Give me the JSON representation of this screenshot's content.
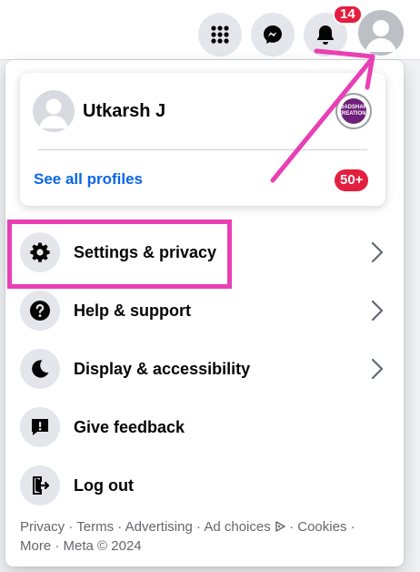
{
  "topbar": {
    "menu_icon": "grid-dots-icon",
    "messenger_icon": "messenger-icon",
    "notifications_icon": "bell-icon",
    "notifications_count": "14",
    "account_icon": "default-avatar-icon"
  },
  "profile_card": {
    "name": "Utkarsh J",
    "see_all_label": "See all profiles",
    "profile_count": "50+",
    "page_avatar_text": "BADSHAH CREATIONS"
  },
  "menu": {
    "items": [
      {
        "label": "Settings & privacy",
        "icon": "gear-icon",
        "has_chevron": true
      },
      {
        "label": "Help & support",
        "icon": "question-icon",
        "has_chevron": true
      },
      {
        "label": "Display & accessibility",
        "icon": "moon-icon",
        "has_chevron": true
      },
      {
        "label": "Give feedback",
        "icon": "feedback-icon",
        "has_chevron": false
      },
      {
        "label": "Log out",
        "icon": "logout-icon",
        "has_chevron": false
      }
    ]
  },
  "footer": {
    "links": [
      "Privacy",
      "Terms",
      "Advertising",
      "Ad choices",
      "Cookies",
      "More",
      "Meta © 2024"
    ],
    "separator": "·"
  },
  "colors": {
    "accent_blue": "#0a66e8",
    "badge_red": "#e41e3f",
    "annotation_pink": "#e93fb5",
    "icon_bg": "#e4e6eb"
  }
}
